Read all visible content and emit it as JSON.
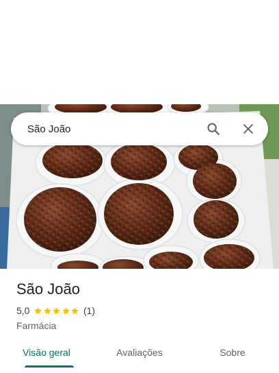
{
  "search": {
    "query": "São João"
  },
  "place": {
    "name": "São João",
    "rating": "5,0",
    "rating_count": "(1)",
    "stars": 5,
    "category": "Farmácia"
  },
  "tabs": [
    {
      "label": "Visão geral",
      "active": true
    },
    {
      "label": "Avaliações",
      "active": false
    },
    {
      "label": "Sobre",
      "active": false
    }
  ],
  "colors": {
    "accent": "#00796b",
    "star": "#fbbc04",
    "text_primary": "#202124",
    "text_secondary": "#5f6368"
  },
  "icons": {
    "search": "search-icon",
    "close": "close-icon",
    "star": "star-icon"
  },
  "image": {
    "subject": "brigadeiros-photo"
  }
}
